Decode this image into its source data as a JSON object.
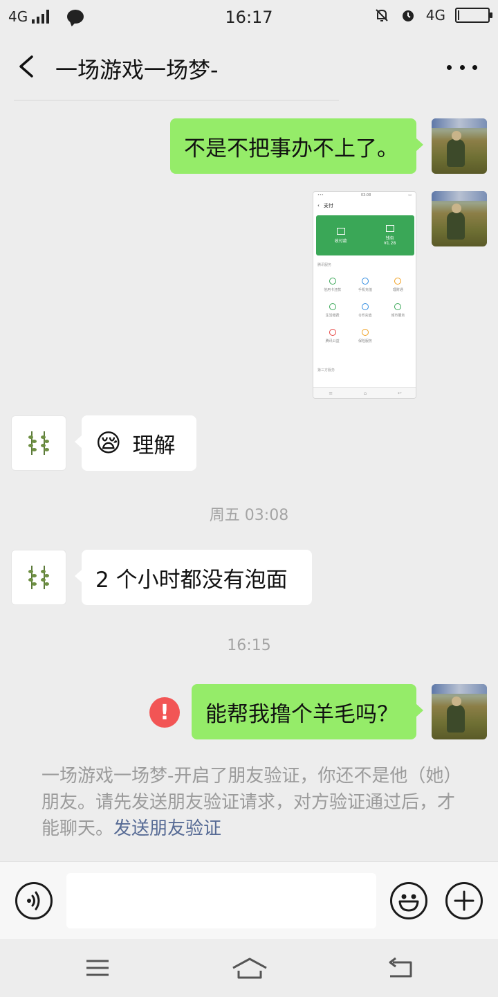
{
  "status_bar": {
    "network_left": "4G",
    "time": "16:17",
    "network_right": "4G",
    "battery_level": 0.05
  },
  "header": {
    "title": "一场游戏一场梦-"
  },
  "messages": {
    "m1_text": "不是不把事办不上了。",
    "m3_emoji": "😪",
    "m3_text": "理解",
    "time_1": "周五 03:08",
    "m4_text": "2 个小时都没有泡面",
    "time_2": "16:15",
    "m5_text": "能帮我撸个羊毛吗？",
    "m5_error_mark": "!"
  },
  "image_message": {
    "status_time": "03:08",
    "title": "支付",
    "btn1": "收付款",
    "btn2": "钱包",
    "btn2_sub": "¥1.28",
    "section1": "腾讯服务",
    "grid": [
      "信用卡还款",
      "手机充值",
      "理财通",
      "生活缴费",
      "Q币充值",
      "城市服务",
      "腾讯公益",
      "保险服务"
    ],
    "section2": "第三方服务"
  },
  "notice": {
    "text": "一场游戏一场梦-开启了朋友验证，你还不是他（她）朋友。请先发送朋友验证请求，对方验证通过后，才能聊天。",
    "link": "发送朋友验证"
  },
  "input_bar": {
    "value": "",
    "placeholder": ""
  },
  "icons": {
    "back": "back-arrow-icon",
    "more": "more-dots-icon",
    "voice": "voice-icon",
    "emoji": "emoji-smile-icon",
    "plus": "plus-icon",
    "error": "error-icon"
  },
  "colors": {
    "my_bubble": "#95ec69",
    "other_bubble": "#ffffff",
    "link": "#576b95",
    "error": "#f25555",
    "background": "#ededed"
  }
}
